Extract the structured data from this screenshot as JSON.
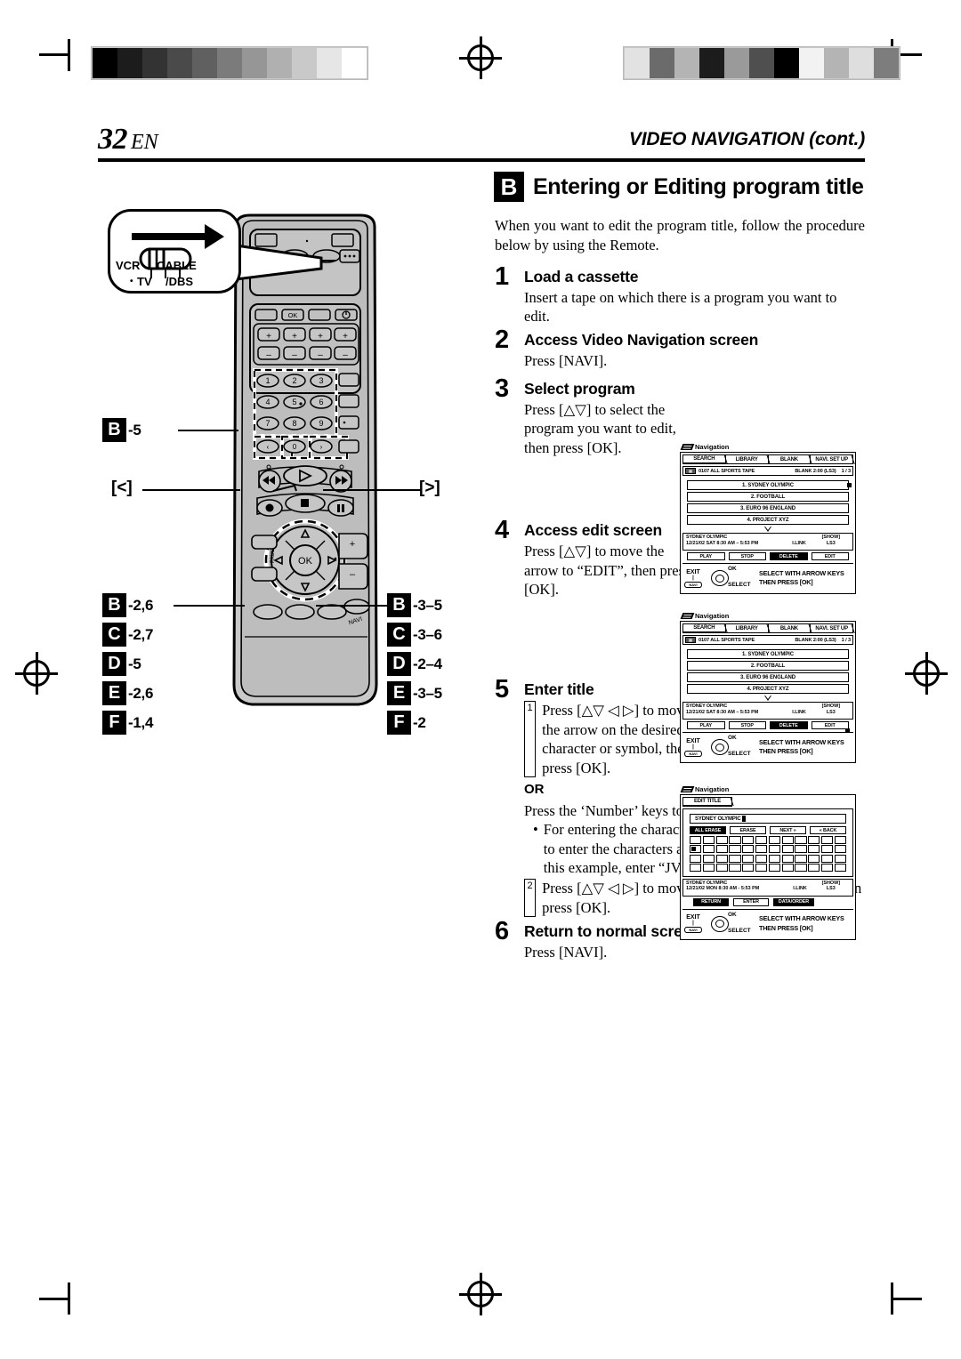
{
  "header": {
    "page_number": "32",
    "page_lang": "EN",
    "section": "VIDEO NAVIGATION (cont.)"
  },
  "section": {
    "badge": "B",
    "title": "Entering or Editing program title",
    "intro": "When you want to edit the program title, follow the procedure below by using the Remote."
  },
  "steps": [
    {
      "num": "1",
      "head": "Load a cassette",
      "body": "Insert a tape on which there is a program you want to edit."
    },
    {
      "num": "2",
      "head": "Access Video Navigation screen",
      "body": "Press [NAVI]."
    },
    {
      "num": "3",
      "head": "Select program",
      "body": "Press [△▽] to select the program you want to edit, then press [OK]."
    },
    {
      "num": "4",
      "head": "Access edit screen",
      "body": "Press [△▽] to move the arrow to “EDIT”, then press [OK]."
    },
    {
      "num": "5",
      "head": "Enter title",
      "sub1_num": "1",
      "sub1": "Press [△▽ ◁ ▷] to move the arrow on the desired character or symbol, then press [OK].",
      "or": "OR",
      "or_body": "Press the ‘Number’ keys to enter the title.",
      "bullet_dot": "•",
      "bullet": "For entering the characters as the title, refer to ‘How to enter the characters and symbols’ on page 31. (In this example, enter “JVC NEWS”.)",
      "sub2_num": "2",
      "sub2": "Press [△▽ ◁ ▷] to move the arrow to “ENTER”, then press [OK]."
    },
    {
      "num": "6",
      "head": "Return to normal screen",
      "body": "Press [NAVI]."
    }
  ],
  "osd_common": {
    "nav_label": "Navigation",
    "guide_exit": "EXIT",
    "guide_navi": "NAVI",
    "guide_ok": "OK",
    "guide_select": "SELECT",
    "guide_line1": "SELECT WITH ARROW KEYS",
    "guide_line2": "THEN PRESS [OK]"
  },
  "osd_search": {
    "tabs": [
      "SEARCH",
      "LIBRARY",
      "BLANK",
      "NAVI. SET UP"
    ],
    "selected_tab": "SEARCH",
    "cassette_icon": "tape-icon",
    "tape_label": "0107 ALL SPORTS TAPE",
    "blank_info": "BLANK 2:00 (LS3)",
    "page_info": "1 / 3",
    "programs": [
      "1. SYDNEY OLYMPIC",
      "2. FOOTBALL",
      "3. EURO 96 ENGLAND",
      "4. PROJECT XYZ"
    ],
    "detail_title": "SYDNEY OLYMPIC",
    "detail_date_step3": "12/21/02 SAT  8:30 AM – 5:53 PM",
    "detail_date_step4": "12/21/02 SAT  8:30 AM – 5:53 PM",
    "detail_ilink": "I.LINK",
    "detail_show": "[SHOW]",
    "detail_speed": "LS3",
    "buttons": [
      "PLAY",
      "STOP",
      "DELETE",
      "EDIT"
    ]
  },
  "osd_edit_title": {
    "tab": "EDIT TITLE",
    "title_value": "SYDNEY OLYMPIC",
    "buttons": [
      "ALL ERASE",
      "ERASE",
      "NEXT »",
      "« BACK"
    ],
    "detail_title": "SYDNEY OLYMPIC",
    "detail_date": "12/21/02 MON   8:30 AM - 5:53 PM",
    "detail_ilink": "I.LINK",
    "detail_show": "[SHOW]",
    "detail_speed": "LS3",
    "bottom_buttons": [
      "RETURN",
      "ENTER",
      "DATA/ORDER"
    ]
  },
  "remote": {
    "switch_callout": {
      "vcr": "VCR",
      "tv": "TV",
      "cable": "CABLE",
      "dbs": "/DBS",
      "tv_dot": "•"
    },
    "keypad_label_badge": "B",
    "keypad_label_text": "-5",
    "left_arrow_label": "[<]",
    "right_arrow_label": "[>]",
    "labels_left": [
      {
        "badge": "B",
        "text": "-2,6"
      },
      {
        "badge": "C",
        "text": "-2,7"
      },
      {
        "badge": "D",
        "text": "-5"
      },
      {
        "badge": "E",
        "text": "-2,6"
      },
      {
        "badge": "F",
        "text": "-1,4"
      }
    ],
    "labels_right": [
      {
        "badge": "B",
        "text": "-3–5"
      },
      {
        "badge": "C",
        "text": "-3–6"
      },
      {
        "badge": "D",
        "text": "-2–4"
      },
      {
        "badge": "E",
        "text": "-3–5"
      },
      {
        "badge": "F",
        "text": "-2"
      }
    ],
    "keys": {
      "ok": "OK",
      "digits": [
        "1",
        "2",
        "3",
        "4",
        "5",
        "6",
        "7",
        "8",
        "9",
        "0"
      ],
      "plus": "+",
      "minus": "–"
    }
  },
  "calibration": {
    "left_strip": [
      "#000000",
      "#1c1c1c",
      "#333333",
      "#4a4a4a",
      "#606060",
      "#7b7b7b",
      "#969696",
      "#b0b0b0",
      "#c9c9c9",
      "#e6e6e6",
      "#ffffff"
    ],
    "right_strip": [
      "#e2e2e2",
      "#6b6b6b",
      "#b4b4b4",
      "#1c1c1c",
      "#9a9a9a",
      "#4f4f4f",
      "#000000",
      "#f2f2f2",
      "#b4b4b4",
      "#dedede",
      "#7d7d7d"
    ]
  }
}
